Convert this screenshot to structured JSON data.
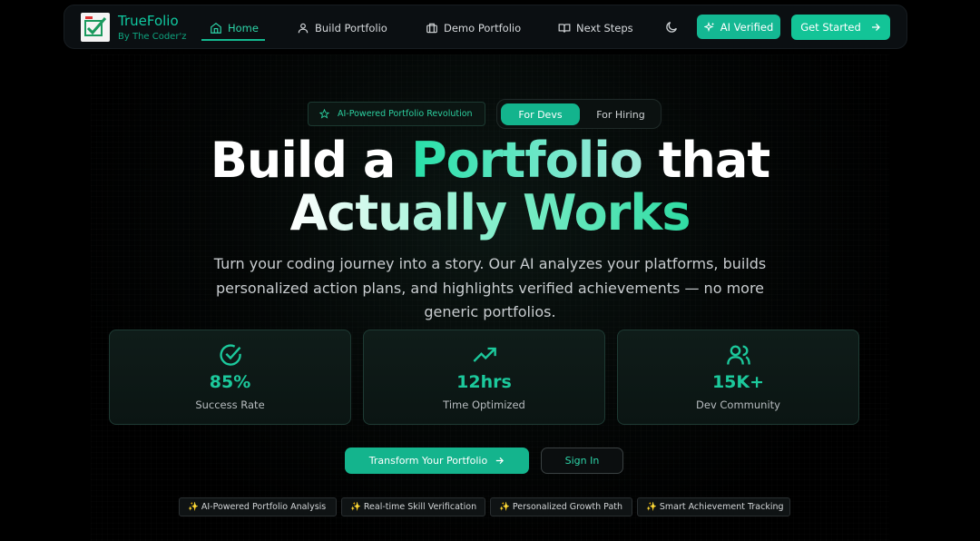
{
  "nav": {
    "brand": "TrueFolio",
    "brand_sub": "By The Coder'z",
    "items": [
      {
        "label": "Home",
        "icon": "home-icon"
      },
      {
        "label": "Build Portfolio",
        "icon": "user-icon"
      },
      {
        "label": "Demo Portfolio",
        "icon": "briefcase-icon"
      },
      {
        "label": "Next Steps",
        "icon": "book-icon"
      }
    ],
    "theme_icon": "moon-icon",
    "verified_label": "AI Verified",
    "cta_label": "Get Started"
  },
  "hero": {
    "badge": "AI-Powered Portfolio Revolution",
    "toggle": {
      "active": "For Devs",
      "inactive": "For Hiring"
    },
    "headline_line1_a": "Build a ",
    "headline_line1_b": "Portfolio",
    "headline_line1_c": " that",
    "headline_line2": "Actually Works",
    "subtitle": "Turn your coding journey into a story. Our AI analyzes your platforms, builds personalized action plans, and highlights verified achievements — no more generic portfolios."
  },
  "stats": [
    {
      "value": "85%",
      "label": "Success Rate",
      "icon": "check-circle-icon"
    },
    {
      "value": "12hrs",
      "label": "Time Optimized",
      "icon": "trending-up-icon"
    },
    {
      "value": "15K+",
      "label": "Dev Community",
      "icon": "users-icon"
    }
  ],
  "cta": {
    "primary": "Transform Your Portfolio",
    "secondary": "Sign In"
  },
  "features": [
    "✨ AI-Powered Portfolio Analysis",
    "✨ Real-time Skill Verification",
    "✨ Personalized Growth Path",
    "✨ Smart Achievement Tracking"
  ],
  "colors": {
    "accent": "#14b893",
    "background": "#000000"
  }
}
